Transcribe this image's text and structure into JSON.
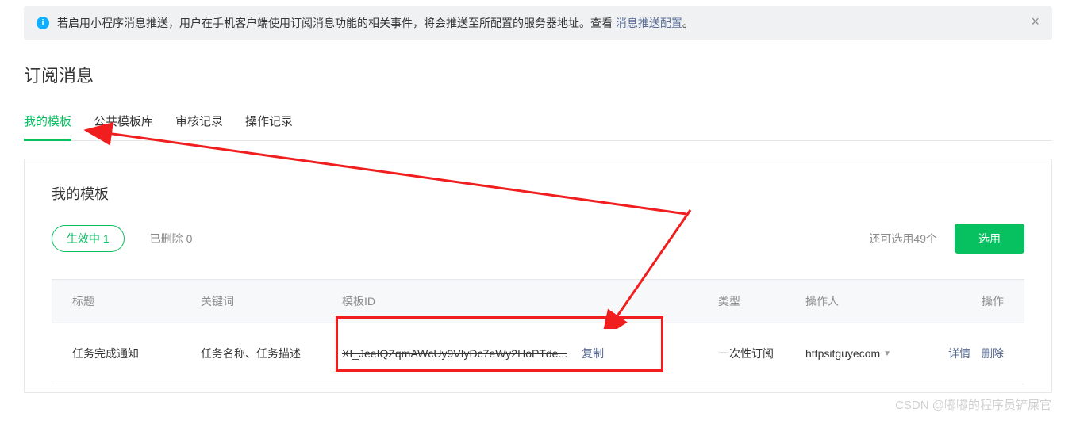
{
  "alert": {
    "text_pre": "若启用小程序消息推送，用户在手机客户端使用订阅消息功能的相关事件，将会推送至所配置的服务器地址。查看 ",
    "link": "消息推送配置",
    "text_post": "。"
  },
  "page_title": "订阅消息",
  "tabs": [
    "我的模板",
    "公共模板库",
    "审核记录",
    "操作记录"
  ],
  "panel": {
    "title": "我的模板",
    "active_pill": "生效中  1",
    "deleted_label": "已删除  0",
    "remaining": "还可选用49个",
    "select_btn": "选用"
  },
  "table": {
    "headers": {
      "title": "标题",
      "keyword": "关键词",
      "template_id": "模板ID",
      "type": "类型",
      "operator": "操作人",
      "action": "操作"
    },
    "row": {
      "title": "任务完成通知",
      "keyword": "任务名称、任务描述",
      "template_id": "XI_JeeIQZqmAWcUy9VIyDc7eWy2HoPTde...",
      "copy": "复制",
      "type": "一次性订阅",
      "operator": "httpsitguyecom",
      "detail": "详情",
      "delete": "删除"
    }
  },
  "watermark": "CSDN @嘟嘟的程序员铲屎官"
}
